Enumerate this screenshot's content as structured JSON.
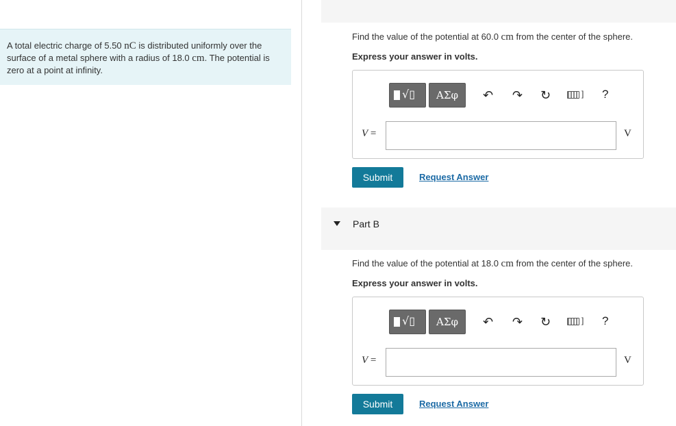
{
  "problem": {
    "text_1": "A total electric charge of 5.50 ",
    "charge_unit": "nC",
    "text_2": " is distributed uniformly over the surface of a metal sphere with a radius of 18.0 ",
    "radius_unit": "cm",
    "text_3": ". The potential is zero at a point at infinity."
  },
  "partA": {
    "q_1": "Find the value of the potential at 60.0 ",
    "q_unit": "cm",
    "q_2": " from the center of the sphere.",
    "express": "Express your answer in volts.",
    "greek_label": "ΑΣφ",
    "help_label": "?",
    "variable": "V",
    "equals": "=",
    "input_value": "",
    "unit": "V",
    "submit_label": "Submit",
    "request_label": "Request Answer"
  },
  "partB": {
    "title": "Part B",
    "q_1": "Find the value of the potential at 18.0 ",
    "q_unit": "cm",
    "q_2": " from the center of the sphere.",
    "express": "Express your answer in volts.",
    "greek_label": "ΑΣφ",
    "help_label": "?",
    "variable": "V",
    "equals": "=",
    "input_value": "",
    "unit": "V",
    "submit_label": "Submit",
    "request_label": "Request Answer"
  },
  "icons": {
    "undo": "undo-icon",
    "redo": "redo-icon",
    "reset": "reset-icon",
    "keyboard": "keyboard-icon",
    "help": "help-icon",
    "caret": "caret-down-icon"
  },
  "colors": {
    "problem_bg": "#e6f4f7",
    "submit_bg": "#137a99",
    "link": "#1b6aa5",
    "toolbar_btn": "#6a6a6a"
  }
}
